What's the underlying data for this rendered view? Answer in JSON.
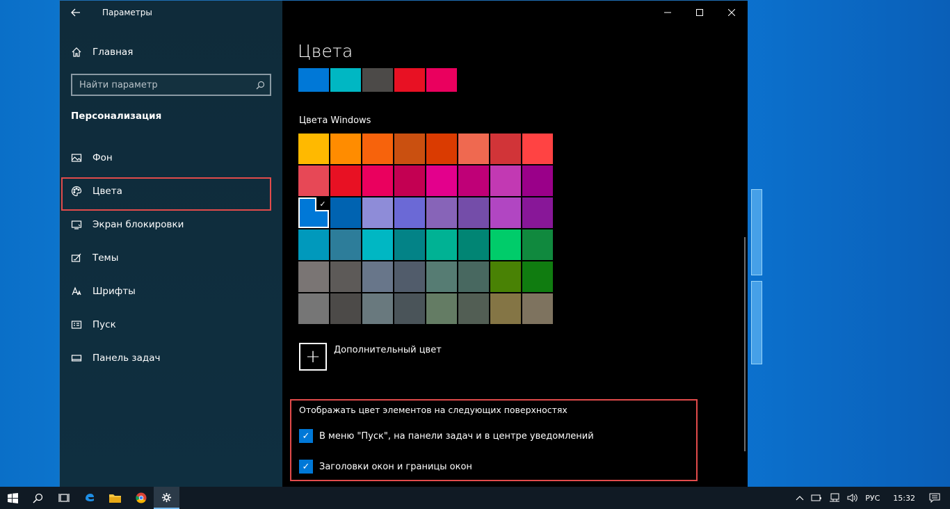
{
  "window": {
    "app_title": "Параметры",
    "back_icon": "arrow-left-icon",
    "caption": {
      "minimize": "—",
      "maximize": "☐",
      "close": "✕"
    }
  },
  "sidebar": {
    "home_label": "Главная",
    "search_placeholder": "Найти параметр",
    "section_title": "Персонализация",
    "items": [
      {
        "label": "Фон",
        "icon": "picture-icon"
      },
      {
        "label": "Цвета",
        "icon": "palette-icon"
      },
      {
        "label": "Экран блокировки",
        "icon": "monitor-icon"
      },
      {
        "label": "Темы",
        "icon": "themes-icon"
      },
      {
        "label": "Шрифты",
        "icon": "font-icon"
      },
      {
        "label": "Пуск",
        "icon": "start-icon"
      },
      {
        "label": "Панель задач",
        "icon": "taskbar-icon"
      }
    ]
  },
  "main": {
    "page_title": "Цвета",
    "recent_colors": [
      "#0078d7",
      "#00b7c3",
      "#4c4a48",
      "#e81123",
      "#ea005e"
    ],
    "windows_colors_label": "Цвета Windows",
    "windows_colors": [
      "#ffb900",
      "#ff8c00",
      "#f7630c",
      "#ca5010",
      "#da3b01",
      "#ef6950",
      "#d13438",
      "#ff4343",
      "#e74856",
      "#e81123",
      "#ea005e",
      "#c30052",
      "#e3008c",
      "#bf0077",
      "#c239b3",
      "#9a0089",
      "#0078d7",
      "#0063b1",
      "#8e8cd8",
      "#6b69d6",
      "#8764b8",
      "#744da9",
      "#b146c2",
      "#881798",
      "#0099bc",
      "#2d7d9a",
      "#00b7c3",
      "#038387",
      "#00b294",
      "#018574",
      "#00cc6a",
      "#10893e",
      "#7a7574",
      "#5d5a58",
      "#68768a",
      "#515c6b",
      "#567c73",
      "#486860",
      "#498205",
      "#107c10",
      "#767676",
      "#4c4a48",
      "#69797e",
      "#4a5459",
      "#647c64",
      "#525e54",
      "#847545",
      "#7e735f"
    ],
    "selected_index": 16,
    "checkmark": "✓",
    "custom_color_label": "Дополнительный цвет",
    "plus_symbol": "+",
    "surfaces_title": "Отображать цвет элементов на следующих поверхностях",
    "checkboxes": [
      {
        "label": "В меню \"Пуск\", на панели задач и в центре уведомлений",
        "checked": true
      },
      {
        "label": "Заголовки окон и границы окон",
        "checked": true
      }
    ]
  },
  "taskbar": {
    "language": "РУС",
    "time": "15:32"
  }
}
